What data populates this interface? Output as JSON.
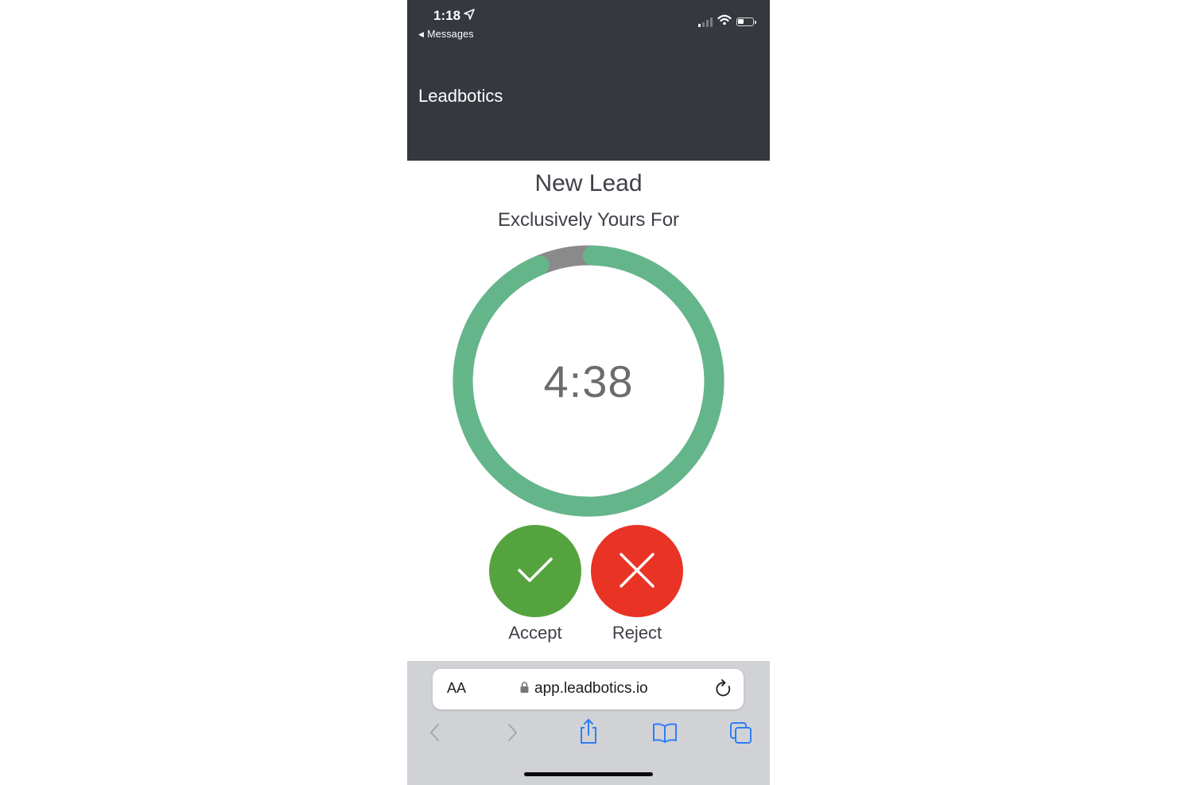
{
  "status_bar": {
    "time": "1:18",
    "back_label": "Messages"
  },
  "header": {
    "app_title": "Leadbotics"
  },
  "main": {
    "title": "New Lead",
    "subtitle": "Exclusively Yours For",
    "timer": {
      "value": "4:38",
      "remaining_fraction": 0.93
    },
    "accept_label": "Accept",
    "reject_label": "Reject"
  },
  "browser": {
    "text_size_label": "AA",
    "url": "app.leadbotics.io"
  },
  "colors": {
    "header_bg": "#35383f",
    "progress_green": "#64b68a",
    "progress_track": "#8a8a8a",
    "accept_green": "#55a33f",
    "reject_red": "#e83325",
    "browser_bg": "#d1d2d6",
    "ios_blue": "#2f7df6"
  },
  "icons": {
    "location": "location-arrow-icon",
    "signal": "cellular-signal-icon",
    "wifi": "wifi-icon",
    "battery": "battery-icon",
    "accept": "checkmark-icon",
    "reject": "x-icon",
    "lock": "lock-icon",
    "reload": "reload-icon",
    "back": "chevron-left-icon",
    "forward": "chevron-right-icon",
    "share": "share-icon",
    "bookmarks": "book-icon",
    "tabs": "tabs-icon"
  }
}
